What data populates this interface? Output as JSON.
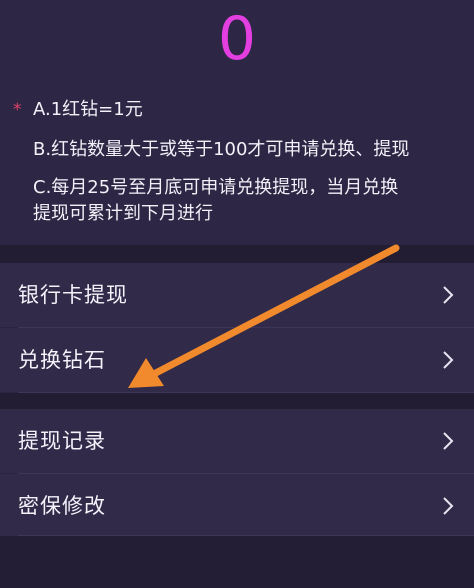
{
  "balance": {
    "value": "0",
    "color": "#e23ee0"
  },
  "notes": {
    "marker": "*",
    "a": "A.1红钻=1元",
    "b": "B.红钻数量大于或等于100才可申请兑换、提现",
    "c_line1": "C.每月25号至月底可申请兑换提现，当月兑换",
    "c_line2": "提现可累计到下月进行"
  },
  "menu": {
    "group1": [
      {
        "label": "银行卡提现",
        "icon": "chevron-right-icon"
      },
      {
        "label": "兑换钻石",
        "icon": "chevron-right-icon"
      }
    ],
    "group2": [
      {
        "label": "提现记录",
        "icon": "chevron-right-icon"
      },
      {
        "label": "密保修改",
        "icon": "chevron-right-icon"
      }
    ]
  },
  "annotation": {
    "icon": "orange-arrow-icon",
    "color": "#f08a2c"
  }
}
